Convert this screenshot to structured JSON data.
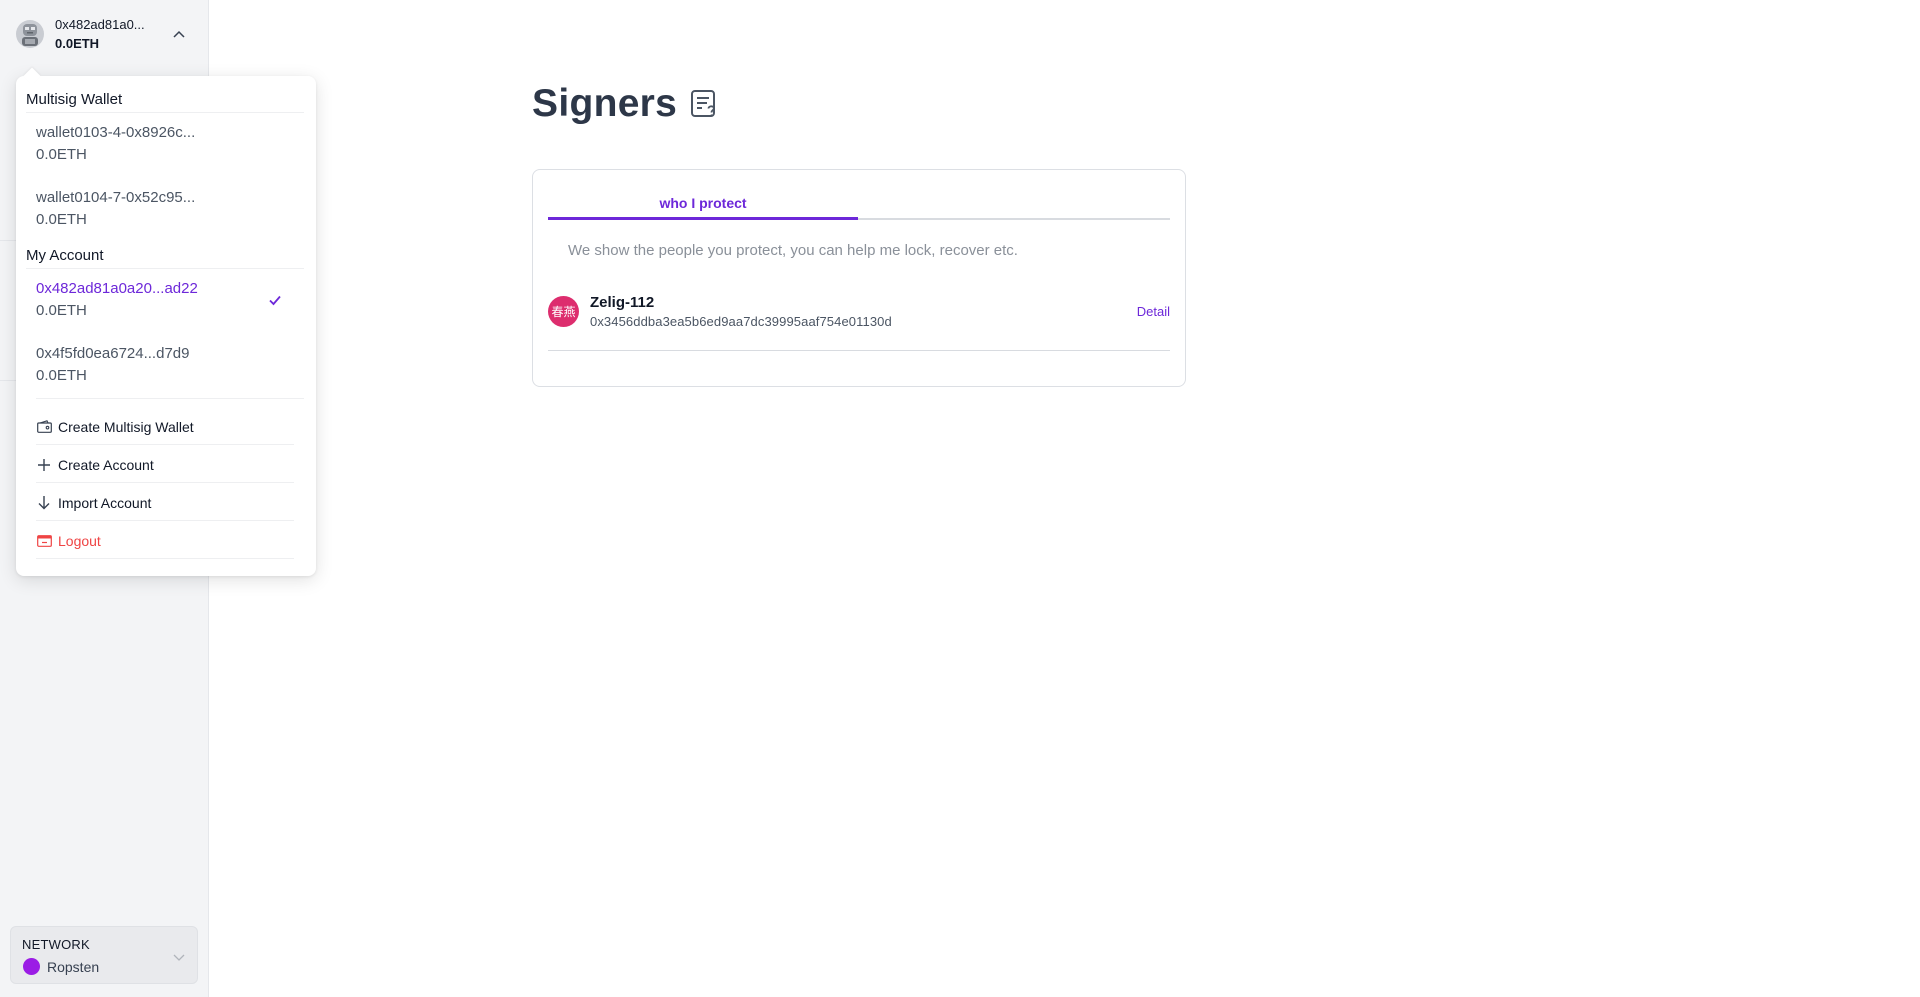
{
  "account_header": {
    "address": "0x482ad81a0...",
    "balance": "0.0ETH",
    "avatar_icon": "robot-avatar-icon",
    "toggle_icon": "chevron-up-icon"
  },
  "dropdown": {
    "multisig_section": "Multisig Wallet",
    "multisig_wallets": [
      {
        "name": "wallet0103-4-0x8926c...",
        "balance": "0.0ETH"
      },
      {
        "name": "wallet0104-7-0x52c95...",
        "balance": "0.0ETH"
      }
    ],
    "account_section": "My Account",
    "accounts": [
      {
        "name": "0x482ad81a0a20...ad22",
        "balance": "0.0ETH",
        "selected": true
      },
      {
        "name": "0x4f5fd0ea6724...d7d9",
        "balance": "0.0ETH",
        "selected": false
      }
    ],
    "actions": {
      "create_multisig": "Create Multisig Wallet",
      "create_account": "Create Account",
      "import_account": "Import Account",
      "logout": "Logout"
    },
    "accent_color": "#6d28d9",
    "logout_color": "#ef4444"
  },
  "network": {
    "label": "NETWORK",
    "name": "Ropsten",
    "dot_color": "#9b1de5"
  },
  "page": {
    "title": "Signers",
    "title_icon": "help-document-icon"
  },
  "card": {
    "tab_active": "who I protect",
    "description": "We show the people you protect, you can help me lock, recover etc.",
    "signers": [
      {
        "avatar_text": "春燕",
        "avatar_color": "#dd2d6e",
        "name": "Zelig-112",
        "address": "0x3456ddba3ea5b6ed9aa7dc39995aaf754e01130d",
        "action": "Detail"
      }
    ]
  }
}
